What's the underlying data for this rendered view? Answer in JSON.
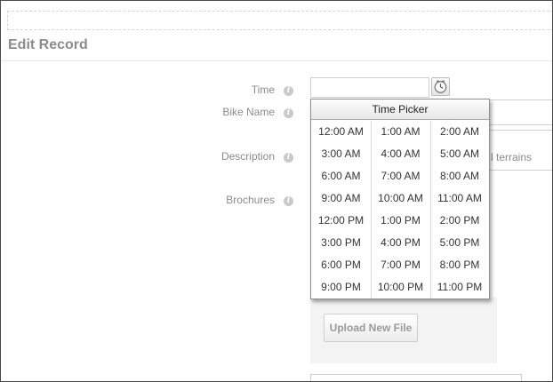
{
  "page": {
    "title": "Edit Record"
  },
  "form": {
    "time": {
      "label": "Time",
      "value": ""
    },
    "bike_name": {
      "label": "Bike Name",
      "value": ""
    },
    "description": {
      "label": "Description",
      "partial_text": "l terrains"
    },
    "brochures": {
      "label": "Brochures",
      "upload_label": "Upload New File"
    }
  },
  "time_picker": {
    "header": "Time Picker",
    "times": [
      "12:00 AM",
      "1:00 AM",
      "2:00 AM",
      "3:00 AM",
      "4:00 AM",
      "5:00 AM",
      "6:00 AM",
      "7:00 AM",
      "8:00 AM",
      "9:00 AM",
      "10:00 AM",
      "11:00 AM",
      "12:00 PM",
      "1:00 PM",
      "2:00 PM",
      "3:00 PM",
      "4:00 PM",
      "5:00 PM",
      "6:00 PM",
      "7:00 PM",
      "8:00 PM",
      "9:00 PM",
      "10:00 PM",
      "11:00 PM"
    ]
  },
  "icons": {
    "info": "info-icon",
    "clock": "clock-icon"
  },
  "colors": {
    "label_text": "#8a8a8a",
    "title_text": "#8c8c8c",
    "info_icon": "#c9c9c9"
  }
}
